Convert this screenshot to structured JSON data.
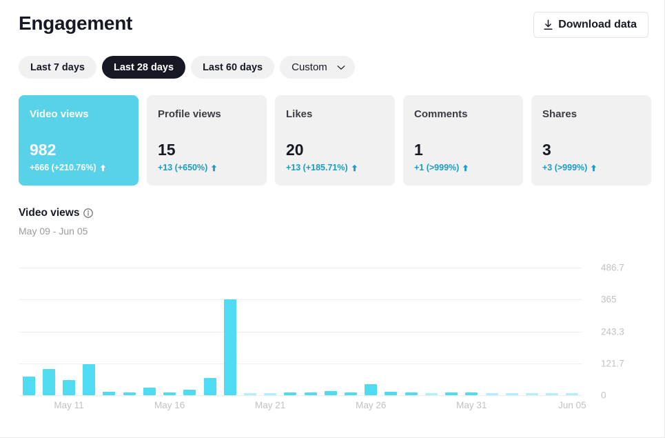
{
  "header": {
    "title": "Engagement",
    "download_label": "Download data",
    "download_icon": "download-icon"
  },
  "date_ranges": {
    "options": [
      {
        "label": "Last 7 days",
        "active": false
      },
      {
        "label": "Last 28 days",
        "active": true
      },
      {
        "label": "Last 60 days",
        "active": false
      }
    ],
    "custom_label": "Custom",
    "custom_icon": "chevron-down-icon"
  },
  "metrics": [
    {
      "label": "Video views",
      "value": "982",
      "delta": "+666 (+210.76%)",
      "trend": "up",
      "selected": true
    },
    {
      "label": "Profile views",
      "value": "15",
      "delta": "+13 (+650%)",
      "trend": "up",
      "selected": false
    },
    {
      "label": "Likes",
      "value": "20",
      "delta": "+13 (+185.71%)",
      "trend": "up",
      "selected": false
    },
    {
      "label": "Comments",
      "value": "1",
      "delta": "+1 (>999%)",
      "trend": "up",
      "selected": false
    },
    {
      "label": "Shares",
      "value": "3",
      "delta": "+3 (>999%)",
      "trend": "up",
      "selected": false
    }
  ],
  "chart_section": {
    "title": "Video views",
    "info_icon": "info-circle-icon",
    "date_range": "May 09 - Jun 05"
  },
  "colors": {
    "accent": "#4fdcf3",
    "card_highlight": "#58d2e8",
    "delta_text": "#1a9bc4",
    "pill_active_bg": "#161823",
    "pill_bg": "#f1f1f2",
    "grid": "#eeeeef",
    "tick_text": "#c2c2c5"
  },
  "chart_data": {
    "type": "bar",
    "title": "Video views",
    "subtitle": "May 09 - Jun 05",
    "xlabel": "",
    "ylabel": "",
    "ylim": [
      0,
      486.7
    ],
    "grid": true,
    "legend": "none",
    "yticks": [
      0,
      121.7,
      243.3,
      365,
      486.7
    ],
    "ytick_labels": [
      "0",
      "121.7",
      "243.3",
      "365",
      "486.7"
    ],
    "xtick_labels": [
      "May 11",
      "May 16",
      "May 21",
      "May 26",
      "May 31",
      "Jun 05"
    ],
    "xtick_indices": [
      2,
      7,
      12,
      17,
      22,
      27
    ],
    "categories": [
      "May 09",
      "May 10",
      "May 11",
      "May 12",
      "May 13",
      "May 14",
      "May 15",
      "May 16",
      "May 17",
      "May 18",
      "May 19",
      "May 20",
      "May 21",
      "May 22",
      "May 23",
      "May 24",
      "May 25",
      "May 26",
      "May 27",
      "May 28",
      "May 29",
      "May 30",
      "May 31",
      "Jun 01",
      "Jun 02",
      "Jun 03",
      "Jun 04",
      "Jun 05"
    ],
    "values": [
      72,
      100,
      59,
      119,
      14,
      8,
      30,
      4,
      20,
      65,
      365,
      0,
      0,
      9,
      5,
      17,
      9,
      42,
      14,
      2,
      0,
      10,
      5,
      0,
      0,
      0,
      0,
      0
    ]
  }
}
